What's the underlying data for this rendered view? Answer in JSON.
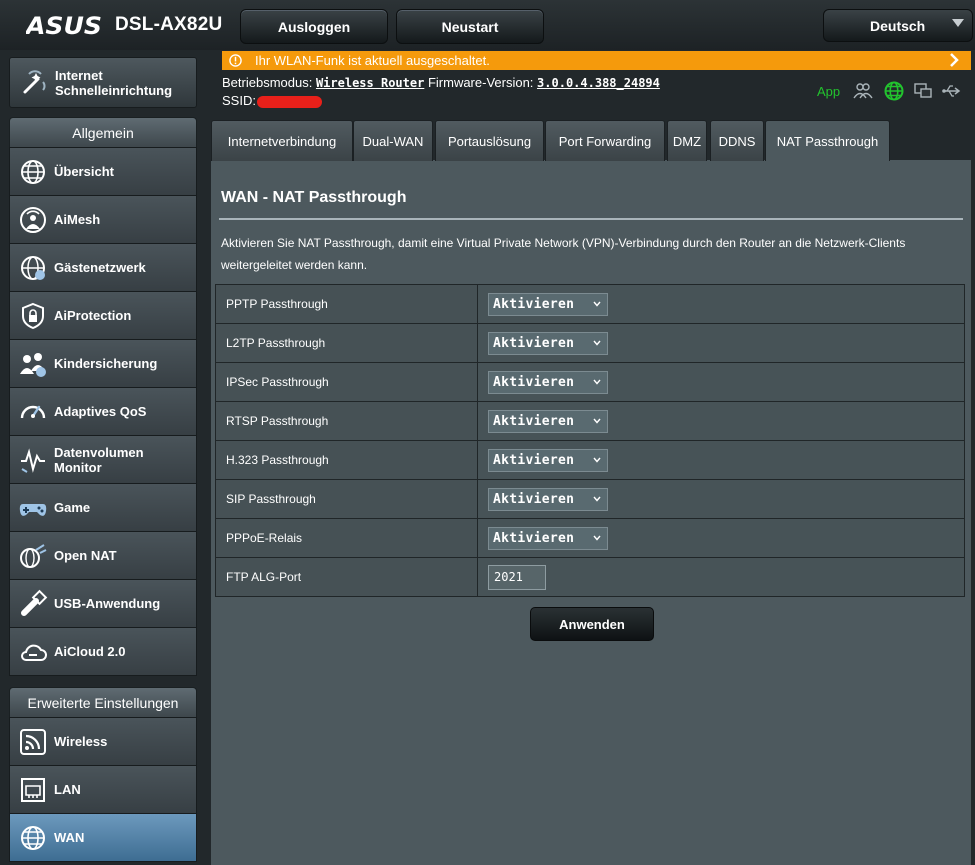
{
  "header": {
    "brand": "ASUS",
    "model": "DSL-AX82U",
    "logout_label": "Ausloggen",
    "reboot_label": "Neustart",
    "language": "Deutsch"
  },
  "sidebar": {
    "quick_setup": "Internet Schnelleinrichtung",
    "general_title": "Allgemein",
    "general_items": [
      {
        "label": "Übersicht",
        "icon": "globe-icon"
      },
      {
        "label": "AiMesh",
        "icon": "aimesh-icon"
      },
      {
        "label": "Gästenetzwerk",
        "icon": "guest-network-icon"
      },
      {
        "label": "AiProtection",
        "icon": "shield-lock-icon"
      },
      {
        "label": "Kindersicherung",
        "icon": "parental-control-icon"
      },
      {
        "label": "Adaptives QoS",
        "icon": "speedometer-icon"
      },
      {
        "label": "Datenvolumen Monitor",
        "icon": "traffic-monitor-icon"
      },
      {
        "label": "Game",
        "icon": "gamepad-icon"
      },
      {
        "label": "Open NAT",
        "icon": "open-nat-icon"
      },
      {
        "label": "USB-Anwendung",
        "icon": "usb-icon"
      },
      {
        "label": "AiCloud 2.0",
        "icon": "cloud-icon"
      }
    ],
    "advanced_title": "Erweiterte Einstellungen",
    "advanced_items": [
      {
        "label": "Wireless",
        "icon": "wireless-icon"
      },
      {
        "label": "LAN",
        "icon": "lan-icon"
      },
      {
        "label": "WAN",
        "icon": "wan-globe-icon",
        "active": true
      }
    ]
  },
  "notice": {
    "text": "Ihr WLAN-Funk ist aktuell ausgeschaltet.",
    "color": "#f59a0c"
  },
  "status": {
    "mode_label": "Betriebsmodus:",
    "mode_value": "Wireless Router",
    "firmware_label": "Firmware-Version:",
    "firmware_value": "3.0.0.4.388_24894",
    "ssid_label": "SSID:",
    "app_label": "App",
    "app_color": "#22c32e"
  },
  "tabs": [
    {
      "label": "Internetverbindung"
    },
    {
      "label": "Dual-WAN"
    },
    {
      "label": "Portauslösung"
    },
    {
      "label": "Port Forwarding"
    },
    {
      "label": "DMZ"
    },
    {
      "label": "DDNS"
    },
    {
      "label": "NAT Passthrough",
      "active": true
    }
  ],
  "page": {
    "title": "WAN - NAT Passthrough",
    "description": "Aktivieren Sie NAT Passthrough, damit eine Virtual Private Network (VPN)-Verbindung durch den Router an die Netzwerk-Clients weitergeleitet werden kann.",
    "rows": [
      {
        "label": "PPTP Passthrough",
        "value": "Aktivieren"
      },
      {
        "label": "L2TP Passthrough",
        "value": "Aktivieren"
      },
      {
        "label": "IPSec Passthrough",
        "value": "Aktivieren"
      },
      {
        "label": "RTSP Passthrough",
        "value": "Aktivieren"
      },
      {
        "label": "H.323 Passthrough",
        "value": "Aktivieren"
      },
      {
        "label": "SIP Passthrough",
        "value": "Aktivieren"
      },
      {
        "label": "PPPoE-Relais",
        "value": "Aktivieren"
      }
    ],
    "ftp_label": "FTP ALG-Port",
    "ftp_value": "2021",
    "apply_label": "Anwenden"
  }
}
